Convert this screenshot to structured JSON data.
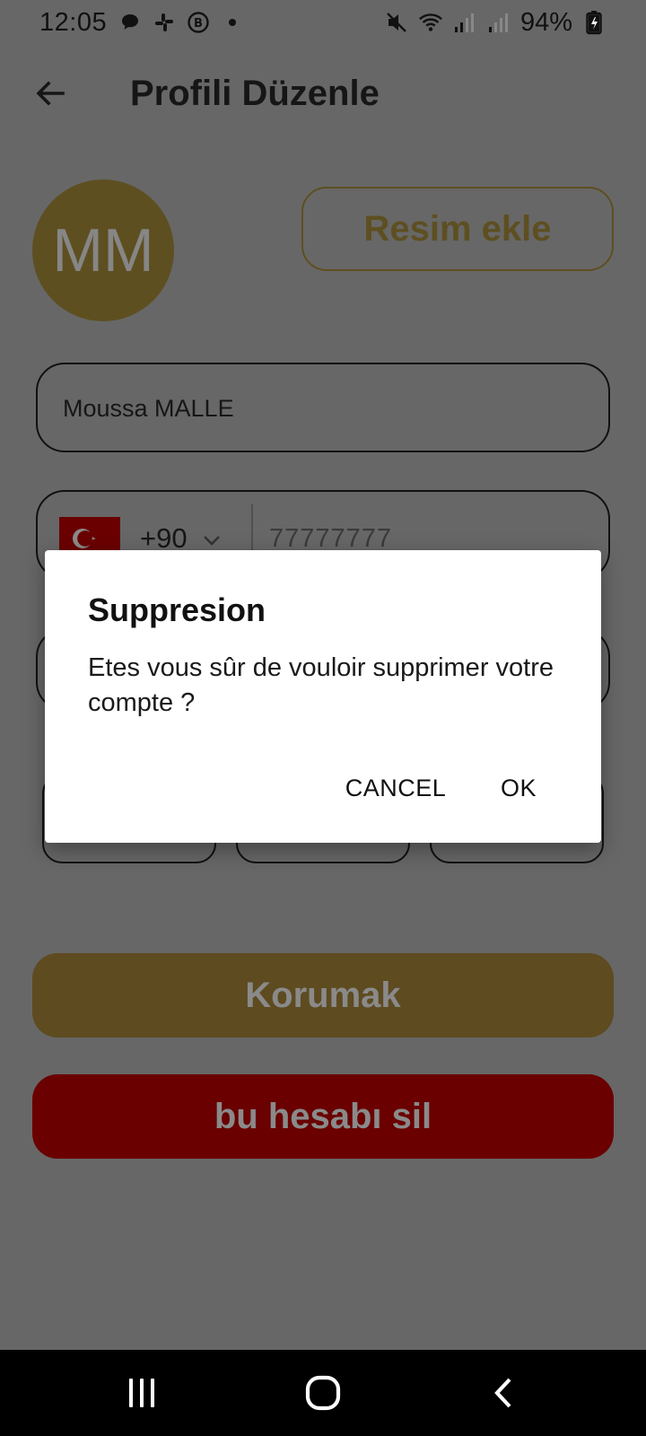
{
  "status_bar": {
    "time": "12:05",
    "battery": "94%",
    "notification_icons": [
      "chat-bubble-icon",
      "slack-icon",
      "b-circle-icon",
      "dot-icon"
    ],
    "system_icons": [
      "mute-icon",
      "wifi-icon",
      "signal-icon",
      "signal-icon",
      "battery-charging-icon"
    ]
  },
  "app_bar": {
    "title": "Profili Düzenle",
    "back_icon": "arrow-left-icon"
  },
  "profile": {
    "avatar_initials": "MM",
    "add_photo_label": "Resim ekle"
  },
  "form": {
    "name_value": "Moussa MALLE",
    "phone": {
      "country_flag": "turkey-flag-icon",
      "dial_code": "+90",
      "number": "77777777"
    }
  },
  "actions": {
    "save_label": "Korumak",
    "delete_label": "bu hesabı sil"
  },
  "dialog": {
    "title": "Suppresion",
    "message": "Etes vous sûr de vouloir supprimer votre compte ?",
    "cancel_label": "CANCEL",
    "ok_label": "OK"
  },
  "colors": {
    "scrim": "#676767",
    "gold_dimmed": "#5e4f21",
    "red_dimmed": "#6a0000",
    "dialog_bg": "#ffffff"
  }
}
